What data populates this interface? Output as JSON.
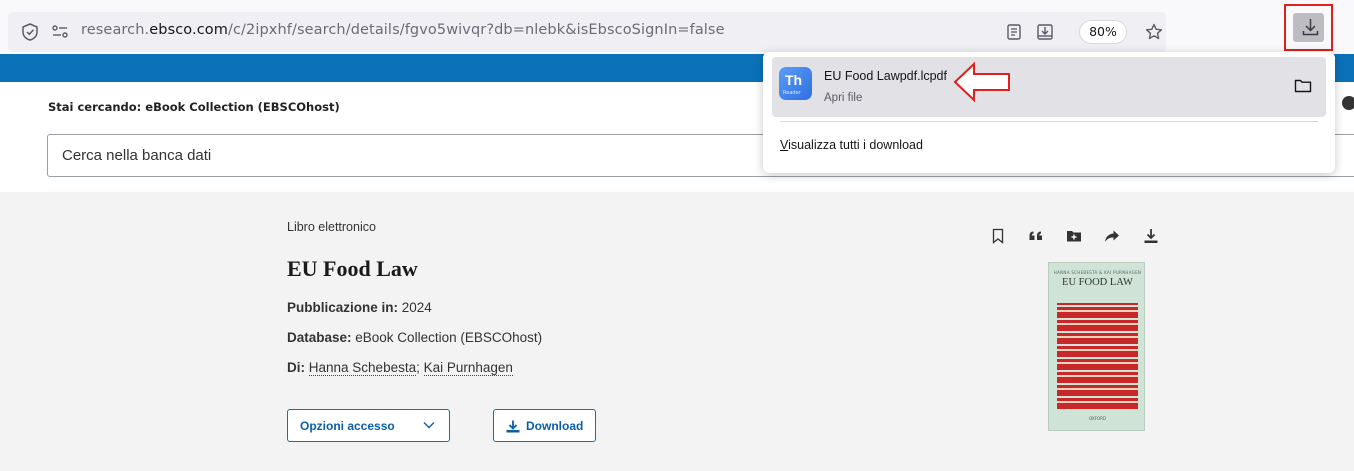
{
  "browser": {
    "url_prefix": "research.",
    "url_domain": "ebsco.com",
    "url_path": "/c/2ipxhf/search/details/fgvo5wivqr?db=nlebk&isEbscoSignIn=false",
    "zoom": "80%"
  },
  "download_popup": {
    "file_name": "EU Food Lawpdf.lcpdf",
    "file_action": "Apri file",
    "app_badge": "Th",
    "app_badge_sub": "Reader",
    "show_all_accesskey": "V",
    "show_all_rest": "isualizza tutti i download"
  },
  "search": {
    "label": "Stai cercando:  eBook Collection (EBSCOhost)",
    "placeholder": "Cerca nella banca dati"
  },
  "record": {
    "type": "Libro elettronico",
    "title": "EU Food Law",
    "publication_label": "Pubblicazione in:",
    "publication_value": " 2024",
    "database_label": "Database:",
    "database_value": " eBook Collection (EBSCOhost)",
    "authors_label": "Di:",
    "authors": [
      "Hanna Schebesta",
      "Kai Purnhagen"
    ],
    "author_separator": "; ",
    "access_button": "Opzioni accesso",
    "download_button": "Download"
  },
  "cover": {
    "authors": "HANNA SCHEBESTA & KAI PURNHAGEN",
    "title": "EU FOOD LAW",
    "publisher": "OXFORD"
  },
  "icons": {
    "site_info": "shield-icon",
    "permissions": "permissions-icon",
    "reader": "reader-view-icon",
    "save": "save-to-pocket-icon",
    "bookmark_star": "star-icon",
    "downloads": "download-icon",
    "folder": "folder-icon",
    "record_tools": [
      "bookmark-icon",
      "quote-icon",
      "add-to-folder-icon",
      "share-icon",
      "download-icon"
    ]
  },
  "colors": {
    "brand_blue": "#0b72b9",
    "highlight_red": "#e0201e",
    "panel_bg": "#f3f3f3"
  }
}
